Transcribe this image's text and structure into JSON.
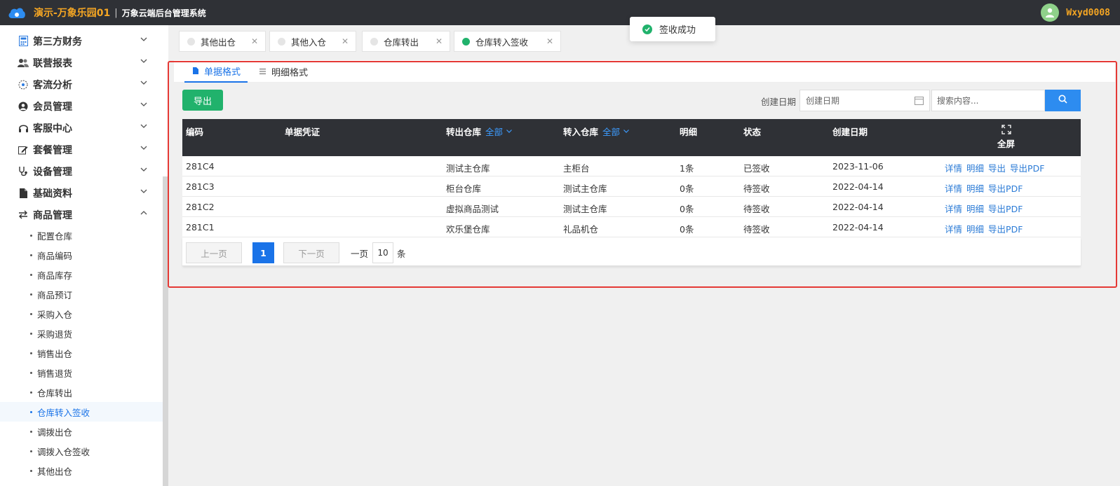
{
  "header": {
    "brand": "演示-万象乐园01",
    "separator": "|",
    "system_title": "万象云端后台管理系统",
    "username": "Wxyd0008"
  },
  "sidebar": {
    "menus": [
      {
        "label": "第三方财务",
        "icon": "calculator-icon"
      },
      {
        "label": "联营报表",
        "icon": "users-icon"
      },
      {
        "label": "客流分析",
        "icon": "target-icon"
      },
      {
        "label": "会员管理",
        "icon": "user-circle-icon"
      },
      {
        "label": "客服中心",
        "icon": "headset-icon"
      },
      {
        "label": "套餐管理",
        "icon": "edit-icon"
      },
      {
        "label": "设备管理",
        "icon": "stethoscope-icon"
      },
      {
        "label": "基础资料",
        "icon": "file-icon"
      },
      {
        "label": "商品管理",
        "icon": "exchange-icon"
      }
    ],
    "sub_items": [
      "配置仓库",
      "商品编码",
      "商品库存",
      "商品预订",
      "采购入仓",
      "采购退货",
      "销售出仓",
      "销售退货",
      "仓库转出",
      "仓库转入签收",
      "调拨出仓",
      "调拨入仓签收",
      "其他出仓"
    ],
    "active_sub": "仓库转入签收"
  },
  "tabs": [
    {
      "label": "其他出仓"
    },
    {
      "label": "其他入仓"
    },
    {
      "label": "仓库转出"
    },
    {
      "label": "仓库转入签收"
    }
  ],
  "toast": {
    "message": "签收成功"
  },
  "content_tabs": [
    {
      "label": "单据格式"
    },
    {
      "label": "明细格式"
    }
  ],
  "toolbar": {
    "export_label": "导出",
    "date_label": "创建日期",
    "date_placeholder": "创建日期",
    "search_placeholder": "搜索内容..."
  },
  "table": {
    "headers": {
      "code": "编码",
      "voucher": "单据凭证",
      "out_wh": "转出仓库",
      "in_wh": "转入仓库",
      "all": "全部",
      "detail": "明细",
      "status": "状态",
      "created": "创建日期",
      "fullscreen": "全屏"
    },
    "rows": [
      {
        "code": "281C4",
        "out_wh": "测试主仓库",
        "in_wh": "主柜台",
        "detail": "1条",
        "status": "已签收",
        "date": "2023-11-06",
        "actions": [
          "详情",
          "明细",
          "导出",
          "导出PDF"
        ]
      },
      {
        "code": "281C3",
        "out_wh": "柜台仓库",
        "in_wh": "测试主仓库",
        "detail": "0条",
        "status": "待签收",
        "date": "2022-04-14",
        "actions": [
          "详情",
          "明细",
          "导出PDF"
        ]
      },
      {
        "code": "281C2",
        "out_wh": "虚拟商品测试",
        "in_wh": "测试主仓库",
        "detail": "0条",
        "status": "待签收",
        "date": "2022-04-14",
        "actions": [
          "详情",
          "明细",
          "导出PDF"
        ]
      },
      {
        "code": "281C1",
        "out_wh": "欢乐堡仓库",
        "in_wh": "礼品机仓",
        "detail": "0条",
        "status": "待签收",
        "date": "2022-04-14",
        "actions": [
          "详情",
          "明细",
          "导出PDF"
        ]
      }
    ]
  },
  "pager": {
    "prev": "上一页",
    "current": "1",
    "next": "下一页",
    "per_page_label": "一页",
    "per_page": "10",
    "unit": "条"
  },
  "colors": {
    "accent": "#1a73e8",
    "success": "#21b26c",
    "header_bg": "#2f3136",
    "brand": "#f5a623",
    "highlight_box": "#e53935"
  }
}
